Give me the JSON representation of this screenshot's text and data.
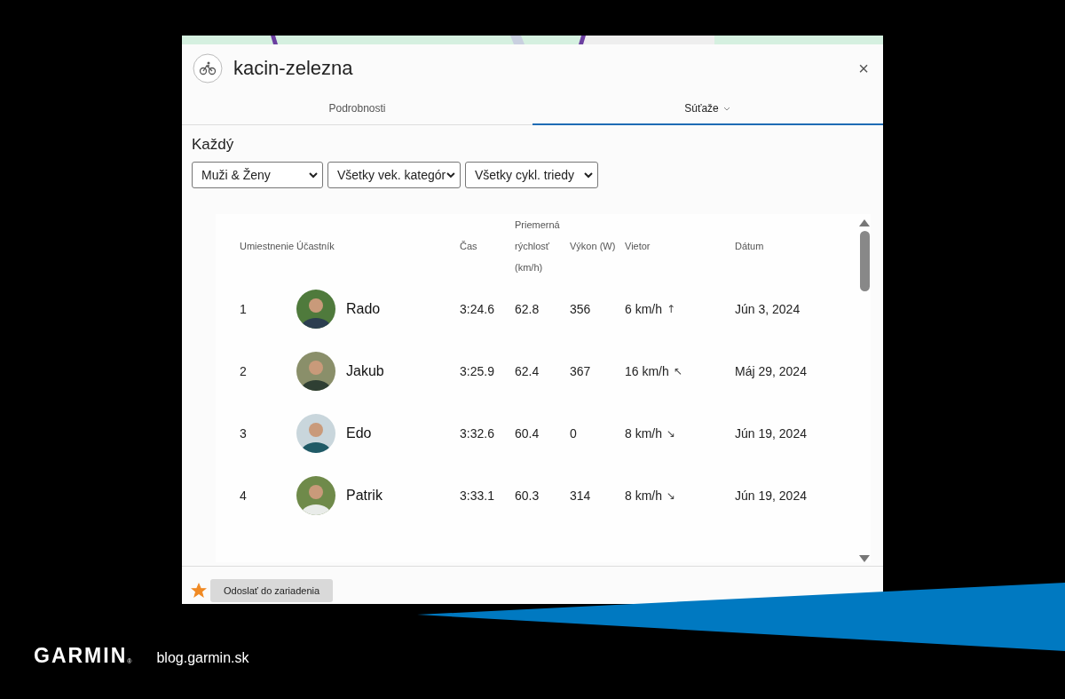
{
  "dialog": {
    "title": "kacin-zelezna",
    "close": "×"
  },
  "tabs": [
    {
      "label": "Podrobnosti",
      "selected": false,
      "dropdown": false
    },
    {
      "label": "Súťaže",
      "selected": true,
      "dropdown": true
    }
  ],
  "filter_title": "Každý",
  "filters": [
    {
      "value": "Muži & Ženy"
    },
    {
      "value": "Všetky vek. kategór"
    },
    {
      "value": "Všetky cykl. triedy"
    }
  ],
  "table": {
    "columns": [
      "Umiestnenie",
      "Účastník",
      "Čas",
      "Priemerná rýchlosť (km/h)",
      "Výkon (W)",
      "Vietor",
      "Dátum"
    ],
    "rows": [
      {
        "place": "1",
        "name": "Rado",
        "time": "3:24.6",
        "speed": "62.8",
        "power": "356",
        "wind": "6 km/h",
        "wind_arrow": "↑",
        "date": "Jún 3, 2024"
      },
      {
        "place": "2",
        "name": "Jakub",
        "time": "3:25.9",
        "speed": "62.4",
        "power": "367",
        "wind": "16 km/h",
        "wind_arrow": "↖",
        "date": "Máj 29, 2024"
      },
      {
        "place": "3",
        "name": "Edo",
        "time": "3:32.6",
        "speed": "60.4",
        "power": "0",
        "wind": "8 km/h",
        "wind_arrow": "↘",
        "date": "Jún 19, 2024"
      },
      {
        "place": "4",
        "name": "Patrik",
        "time": "3:33.1",
        "speed": "60.3",
        "power": "314",
        "wind": "8 km/h",
        "wind_arrow": "↘",
        "date": "Jún 19, 2024"
      }
    ]
  },
  "footer": {
    "favorite": true,
    "button": "Odoslať do zariadenia"
  },
  "brand": {
    "logo": "GARMIN",
    "mark": "®",
    "site": "blog.garmin.sk"
  }
}
